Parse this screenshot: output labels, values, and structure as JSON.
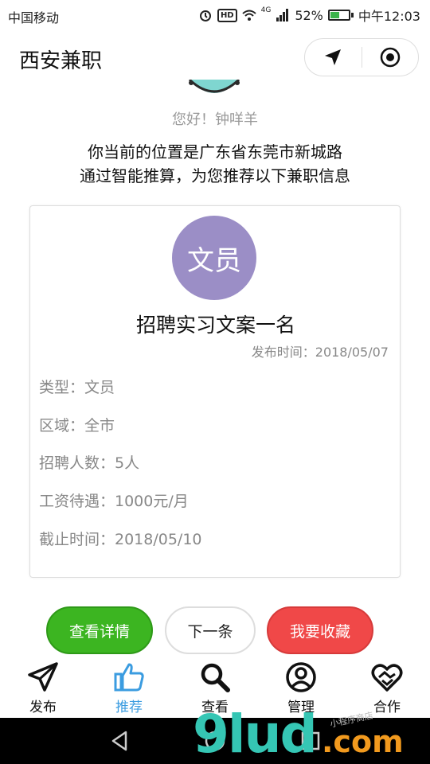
{
  "status_bar": {
    "carrier": "中国移动",
    "hd": "HD",
    "network": "4G",
    "battery": "52%",
    "time": "中午12:03"
  },
  "header": {
    "title": "西安兼职",
    "nav_icon": "location-arrow-icon",
    "close_icon": "target-icon"
  },
  "greeting": "您好！钟咩羊",
  "location": {
    "line1": "你当前的位置是广东省东莞市新城路",
    "line2": "通过智能推算，为您推荐以下兼职信息"
  },
  "job": {
    "badge": "文员",
    "badge_color": "#9b8ec6",
    "title": "招聘实习文案一名",
    "publish": "发布时间：2018/05/07",
    "type": "类型：文员",
    "area": "区域：全市",
    "count": "招聘人数：5人",
    "salary": "工资待遇：1000元/月",
    "deadline": "截止时间：2018/05/10"
  },
  "buttons": {
    "detail": "查看详情",
    "next": "下一条",
    "favorite": "我要收藏"
  },
  "tabs": [
    {
      "label": "发布",
      "icon": "paper-plane-icon"
    },
    {
      "label": "推荐",
      "icon": "thumbs-up-icon"
    },
    {
      "label": "查看",
      "icon": "search-icon"
    },
    {
      "label": "管理",
      "icon": "user-circle-icon"
    },
    {
      "label": "合作",
      "icon": "handshake-heart-icon"
    }
  ],
  "colors": {
    "active_tab": "#3b9ce0",
    "green": "#3cb521",
    "red": "#f04848"
  },
  "watermark": {
    "text": "9lud",
    "suffix": ".com",
    "small": "小程序商店"
  }
}
